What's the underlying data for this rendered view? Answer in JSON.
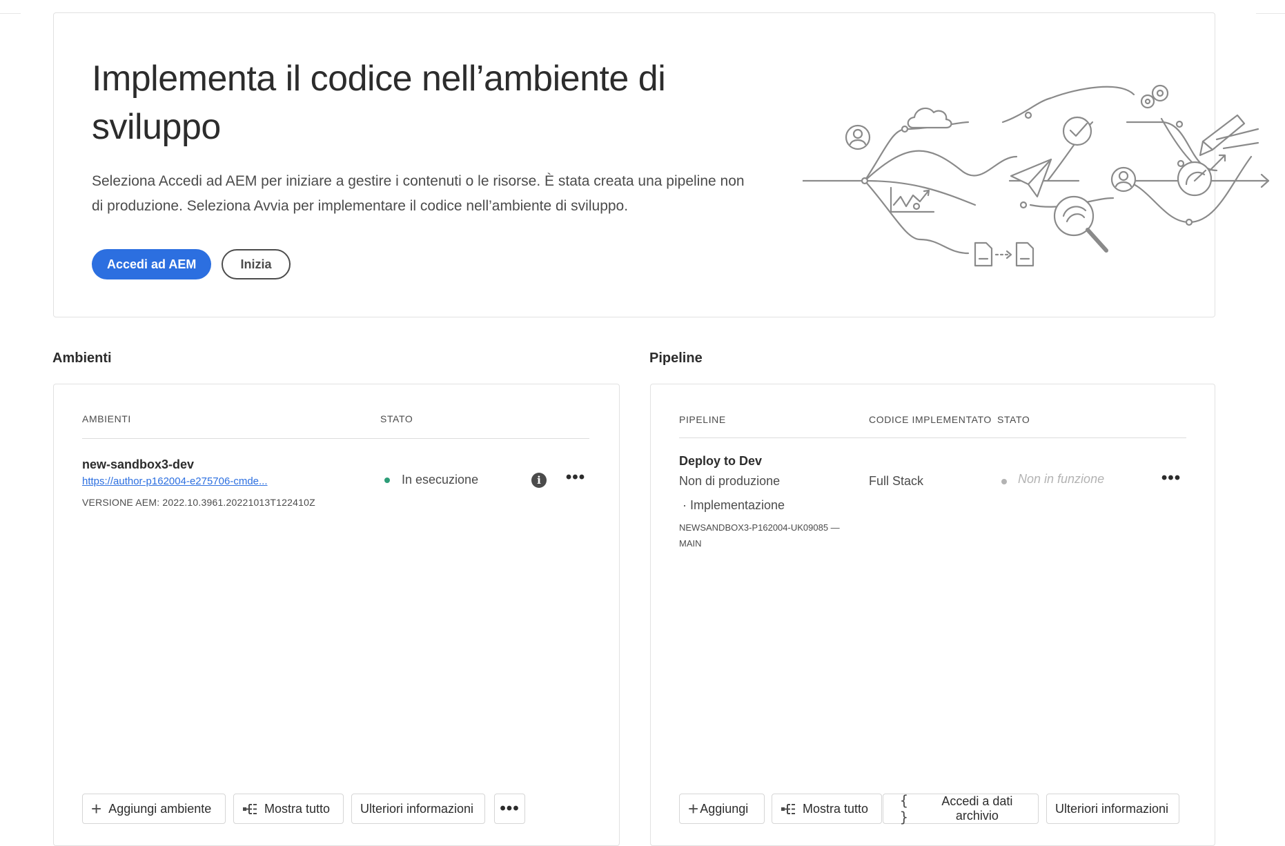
{
  "hero": {
    "title": "Implementa il codice nell’ambiente di sviluppo",
    "description": "Seleziona Accedi ad AEM per iniziare a gestire i contenuti o le risorse. È stata creata una pipeline non di produzione. Seleziona Avvia per implementare il codice nell’ambiente di sviluppo.",
    "primary_button": "Accedi ad AEM",
    "secondary_button": "Inizia",
    "illustration": "workflow-illustration"
  },
  "environments": {
    "section_title": "Ambienti",
    "headers": {
      "name": "AMBIENTI",
      "status": "STATO"
    },
    "rows": [
      {
        "name": "new-sandbox3-dev",
        "url": "https://author-p162004-e275706-cmde...",
        "version": "VERSIONE AEM: 2022.10.3961.20221013T122410Z",
        "status": "In esecuzione",
        "status_color": "#2d9d78"
      }
    ],
    "actions": {
      "add": "Aggiungi ambiente",
      "show_all": "Mostra tutto",
      "learn_more": "Ulteriori informazioni"
    }
  },
  "pipelines": {
    "section_title": "Pipeline",
    "headers": {
      "name": "PIPELINE",
      "code": "CODICE IMPLEMENTATO",
      "status": "STATO"
    },
    "rows": [
      {
        "name": "Deploy to Dev",
        "type": "Non di produzione",
        "phase": "· Implementazione",
        "repo": "NEWSANDBOX3-P162004-UK09085 — MAIN",
        "code": "Full Stack",
        "status": "Non in funzione",
        "status_color": "#b3b3b3"
      }
    ],
    "actions": {
      "add": "Aggiungi",
      "show_all": "Mostra tutto",
      "repo": "Accedi a dati archivio",
      "learn_more": "Ulteriori informazioni"
    }
  },
  "colors": {
    "accent": "#2c6fe0",
    "text": "#2c2c2c",
    "border": "#e1e1e1"
  }
}
